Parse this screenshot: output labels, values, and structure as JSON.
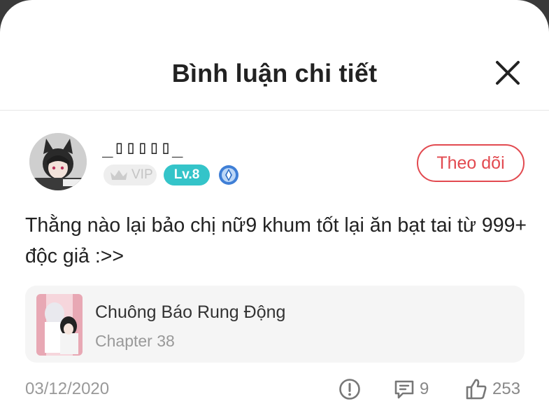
{
  "header": {
    "title": "Bình luận chi tiết",
    "close_icon": "close-icon"
  },
  "user": {
    "name": "_▯▯▯▯▯_",
    "vip_label": "VIP",
    "level_label": "Lv.8",
    "medal_icon": "medal-icon",
    "follow_label": "Theo dõi"
  },
  "comment": {
    "text": "Thằng nào lại bảo chị nữ9 khum tốt lại ăn bạt tai từ 999+ độc giả :>>",
    "date": "03/12/2020"
  },
  "comic": {
    "title": "Chuông Báo Rung Động",
    "chapter": "Chapter 38"
  },
  "actions": {
    "report_icon": "report-icon",
    "reply_icon": "reply-icon",
    "reply_count": "9",
    "like_icon": "thumbs-up-icon",
    "like_count": "253"
  },
  "colors": {
    "accent_red": "#e24a50",
    "level_teal": "#34c4c9",
    "muted_gray": "#999999"
  }
}
